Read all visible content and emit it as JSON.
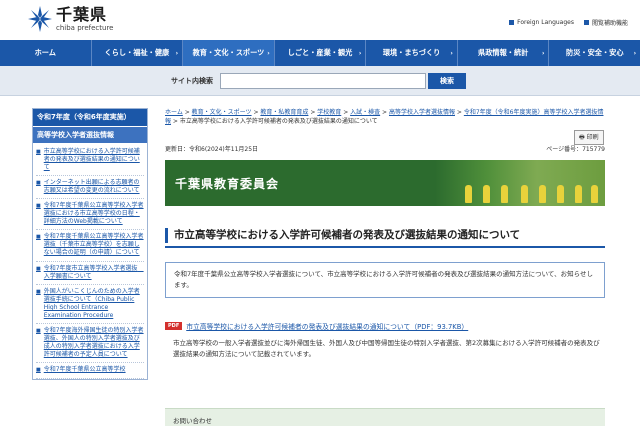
{
  "header": {
    "logo_main": "千葉県",
    "logo_sub": "chiba prefecture",
    "links": [
      "Foreign Languages",
      "閲覧補助機能"
    ]
  },
  "nav": {
    "items": [
      {
        "label": "ホーム"
      },
      {
        "label": "くらし・福祉・健康"
      },
      {
        "label": "教育・文化・スポーツ"
      },
      {
        "label": "しごと・産業・観光"
      },
      {
        "label": "環境・まちづくり"
      },
      {
        "label": "県政情報・統計"
      },
      {
        "label": "防災・安全・安心"
      }
    ]
  },
  "search": {
    "label": "サイト内検索",
    "placeholder": "",
    "button": "検索"
  },
  "sidebar": {
    "heading": "令和7年度（令和6年度実施）",
    "heading2": "高等学校入学者選抜情報",
    "items": [
      {
        "label": "市立高等学校における入学許可候補者の発表及び選抜結果の通知について"
      },
      {
        "label": "インターネット出願による志願者の志願又は希望の変更の流れについて"
      },
      {
        "label": "令和7年度千葉県公立高等学校入学者選抜における市立高等学校の日程・詳細方法のWeb掲載について"
      },
      {
        "label": "令和7年度千葉県公立高等学校入学者選抜（千葉市立高等学校）を志願しない場合の証明（の申請）について"
      },
      {
        "label": "令和7年度市立高等学校入学者選抜　入学願書について"
      },
      {
        "label": "外国人がいこくじんのための入学者選抜手続について（Chiba Public High School Entrance Examination Procedure"
      },
      {
        "label": "令和7年度海外帰国生徒の特別入学者選抜、外国人の特別入学者選抜及び成人の特別入学者選抜における入学許可候補者の予定人員について"
      },
      {
        "label": "令和7年度千葉県公立高等学校"
      }
    ]
  },
  "main": {
    "breadcrumb": [
      {
        "label": "ホーム",
        "link": true
      },
      {
        "label": " > ",
        "link": false
      },
      {
        "label": "教育・文化・スポーツ",
        "link": true
      },
      {
        "label": " > ",
        "link": false
      },
      {
        "label": "教育・私教育育成",
        "link": true
      },
      {
        "label": " > ",
        "link": false
      },
      {
        "label": "学校教育",
        "link": true
      },
      {
        "label": " > ",
        "link": false
      },
      {
        "label": "入試・検査",
        "link": true
      },
      {
        "label": " > ",
        "link": false
      },
      {
        "label": "高等学校入学者選抜情報",
        "link": true
      },
      {
        "label": " > ",
        "link": false
      },
      {
        "label": "令和7年度（令和6年度実施）高等学校入学者選抜情報",
        "link": true
      },
      {
        "label": " > 市立高等学校における入学許可候補者の発表及び選抜結果の通知について",
        "link": false
      }
    ],
    "print_label": "印刷",
    "updated": "更新日：令和6(2024)年11月25日",
    "page_id": "ページ番号：715779",
    "banner_title": "千葉県教育委員会",
    "page_title": "市立高等学校における入学許可候補者の発表及び選抜結果の通知について",
    "notice": "令和7年度千葉県公立高等学校入学者選抜について、市立高等学校における入学許可候補者の発表及び選抜結果の通知方法について、お知らせします。",
    "pdf_badge": "PDF",
    "pdf_link": "市立高等学校における入学許可候補者の発表及び選抜結果の通知について（PDF：93.7KB）",
    "description": "市立高等学校の一般入学者選抜並びに海外帰国生徒、外国人及び中国等帰国生徒の特別入学者選抜、第2次募集における入学許可候補者の発表及び選抜結果の通知方法について記載されています。",
    "contact_heading": "お問い合わせ"
  },
  "colors": {
    "nav": "#1b57a8",
    "banner": "#2c6b2e",
    "pdf": "#d3302d"
  }
}
